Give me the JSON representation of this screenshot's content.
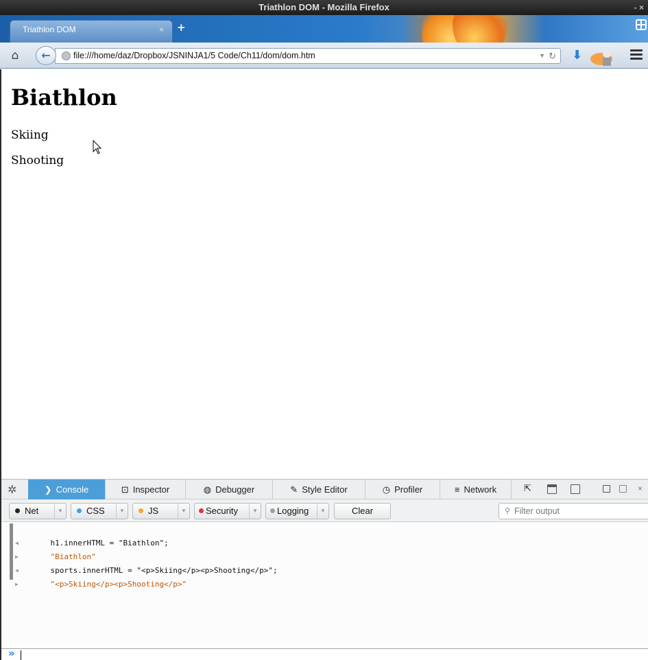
{
  "window": {
    "title": "Triathlon DOM - Mozilla Firefox",
    "controls": "- ×"
  },
  "tabs": [
    {
      "label": "Triathlon DOM",
      "close": "×"
    }
  ],
  "new_tab": "+",
  "navbar": {
    "url": "file:///home/daz/Dropbox/JSNINJA1/5 Code/Ch11/dom/dom.htm",
    "icons": [
      "home-icon",
      "back-icon",
      "globe-icon",
      "dropdown-icon",
      "reload-icon",
      "download-icon",
      "menu-icon"
    ]
  },
  "page": {
    "heading": "Biathlon",
    "paragraphs": [
      "Skiing",
      "Shooting"
    ]
  },
  "devtools": {
    "tabs": [
      {
        "label": "Console",
        "icon": "console-icon",
        "active": true
      },
      {
        "label": "Inspector",
        "icon": "inspector-icon"
      },
      {
        "label": "Debugger",
        "icon": "debugger-icon"
      },
      {
        "label": "Style Editor",
        "icon": "style-editor-icon"
      },
      {
        "label": "Profiler",
        "icon": "profiler-icon"
      },
      {
        "label": "Network",
        "icon": "network-icon"
      }
    ],
    "filters": [
      {
        "label": "Net",
        "dot": "#222222"
      },
      {
        "label": "CSS",
        "dot": "#3da6e8"
      },
      {
        "label": "JS",
        "dot": "#f5a430"
      },
      {
        "label": "Security",
        "dot": "#e3343a"
      },
      {
        "label": "Logging",
        "dot": "#a0a0a0"
      }
    ],
    "clear_label": "Clear",
    "filter_placeholder": "Filter output",
    "log": [
      {
        "kind": "input",
        "text": "h1.innerHTML = \"Biathlon\";"
      },
      {
        "kind": "result",
        "text": "\"Biathlon\""
      },
      {
        "kind": "input",
        "text": "sports.innerHTML = \"<p>Skiing</p><p>Shooting</p>\";"
      },
      {
        "kind": "result",
        "text": "\"<p>Skiing</p><p>Shooting</p>\""
      }
    ],
    "prompt": "»"
  },
  "colors": {
    "active_tab": "#4c9ed9",
    "result_text": "#bf5400",
    "prompt": "#2f7fd6"
  }
}
